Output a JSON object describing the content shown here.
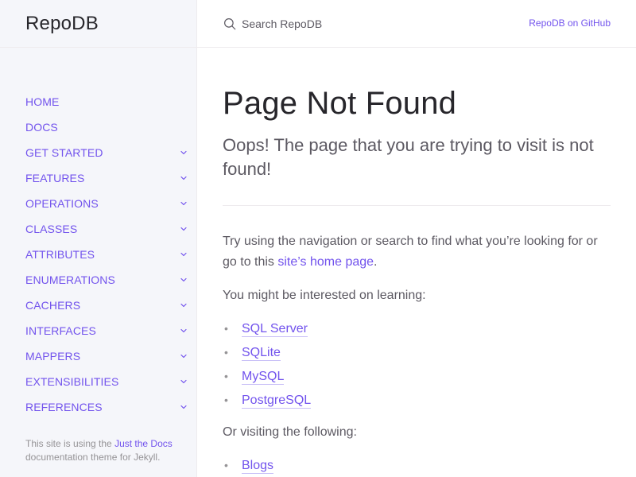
{
  "site": {
    "title": "RepoDB"
  },
  "search": {
    "placeholder": "Search RepoDB"
  },
  "aux": {
    "github_label": "RepoDB on GitHub"
  },
  "sidebar": {
    "items": [
      {
        "label": "HOME",
        "expandable": false
      },
      {
        "label": "DOCS",
        "expandable": false
      },
      {
        "label": "GET STARTED",
        "expandable": true
      },
      {
        "label": "FEATURES",
        "expandable": true
      },
      {
        "label": "OPERATIONS",
        "expandable": true
      },
      {
        "label": "CLASSES",
        "expandable": true
      },
      {
        "label": "ATTRIBUTES",
        "expandable": true
      },
      {
        "label": "ENUMERATIONS",
        "expandable": true
      },
      {
        "label": "CACHERS",
        "expandable": true
      },
      {
        "label": "INTERFACES",
        "expandable": true
      },
      {
        "label": "MAPPERS",
        "expandable": true
      },
      {
        "label": "EXTENSIBILITIES",
        "expandable": true
      },
      {
        "label": "REFERENCES",
        "expandable": true
      }
    ],
    "footer": {
      "prefix": "This site is using the ",
      "link": "Just the Docs",
      "suffix": " documentation theme for Jekyll."
    }
  },
  "main": {
    "title": "Page Not Found",
    "subtitle": "Oops! The page that you are trying to visit is not found!",
    "nav_hint_prefix": "Try using the navigation or search to find what you’re looking for or go to this ",
    "nav_hint_link": "site’s home page",
    "nav_hint_suffix": ".",
    "learning_label": "You might be interested on learning:",
    "learning_links": [
      "SQL Server",
      "SQLite",
      "MySQL",
      "PostgreSQL"
    ],
    "visiting_label": "Or visiting the following:",
    "visiting_links": [
      "Blogs"
    ]
  },
  "colors": {
    "accent": "#7253ed",
    "text": "#5c5962",
    "heading": "#27262b",
    "sidebar_bg": "#f5f6fa",
    "border": "#eeebee",
    "muted": "#959396"
  },
  "icons": {
    "search": "search-icon",
    "expander": "chevron-down-icon",
    "bullet": "bullet-dot"
  }
}
